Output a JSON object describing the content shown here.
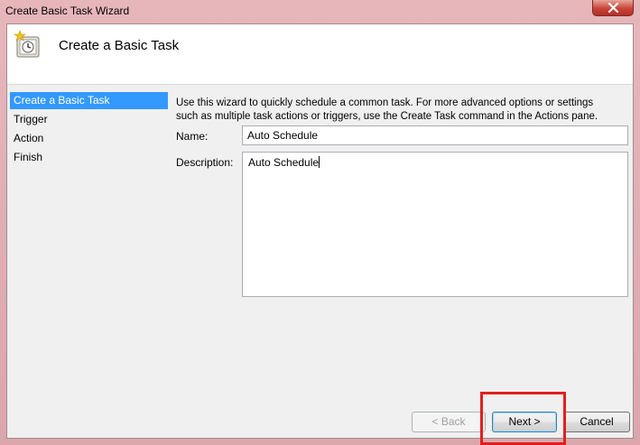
{
  "window": {
    "title": "Create Basic Task Wizard"
  },
  "header": {
    "title": "Create a Basic Task",
    "icon": "task-scheduler-clock-icon"
  },
  "steps": [
    {
      "label": "Create a Basic Task",
      "active": true
    },
    {
      "label": "Trigger",
      "active": false
    },
    {
      "label": "Action",
      "active": false
    },
    {
      "label": "Finish",
      "active": false
    }
  ],
  "form": {
    "intro_line1": "Use this wizard to quickly schedule a common task.  For more advanced options or settings",
    "intro_line2": "such as multiple task actions or triggers, use the Create Task command in the Actions pane.",
    "name_label": "Name:",
    "name_value": "Auto Schedule",
    "description_label": "Description:",
    "description_value": "Auto Schedule"
  },
  "buttons": {
    "back": "< Back",
    "next": "Next >",
    "cancel": "Cancel"
  },
  "colors": {
    "title_bar": "#e7b6bb",
    "selected_step": "#3399ff",
    "highlight_box": "#e0201f",
    "close_button": "#c7443a"
  }
}
